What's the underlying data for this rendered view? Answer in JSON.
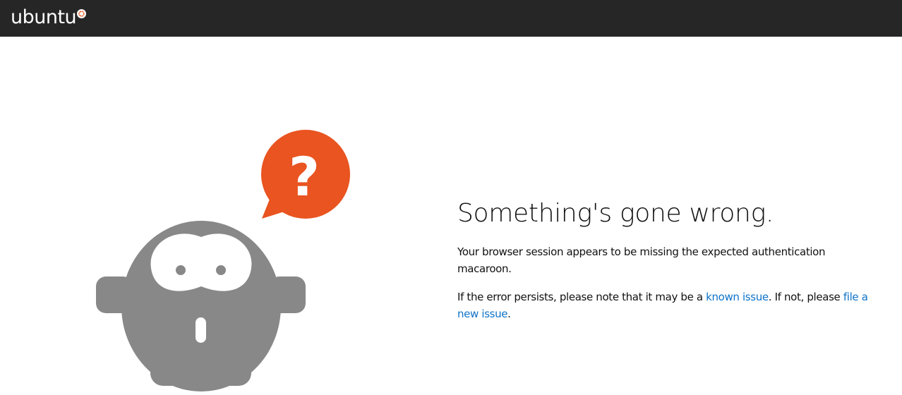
{
  "header": {
    "logo_text": "ubuntu",
    "logo_mark_icon": "circle-of-friends-icon",
    "background_color": "#262626"
  },
  "illustration": {
    "character_icon": "confused-creature-icon",
    "bubble_icon": "question-mark-speech-bubble-icon",
    "bubble_glyph": "?",
    "character_color": "#888888",
    "bubble_color": "#e95420"
  },
  "error": {
    "heading": "Something's gone wrong.",
    "message": "Your browser session appears to be missing the expected authentication macaroon.",
    "persist_prefix": "If the error persists, please note that it may be a ",
    "known_issue_link": "known issue",
    "persist_middle": ". If not, please ",
    "file_issue_link": "file a new issue",
    "persist_suffix": "."
  },
  "colors": {
    "link": "#0e73c8",
    "text": "#111111",
    "background": "#ffffff"
  }
}
